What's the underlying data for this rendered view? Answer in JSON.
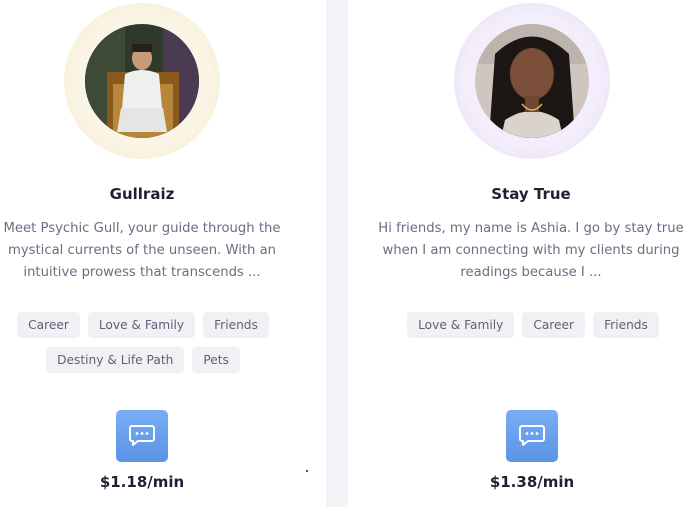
{
  "advisors": [
    {
      "name": "Gullraiz",
      "bio": "Meet Psychic Gull, your guide through the mystical currents of the unseen. With an intuitive prowess that transcends ...",
      "tags": [
        "Career",
        "Love & Family",
        "Friends",
        "Destiny & Life Path",
        "Pets"
      ],
      "price": "$1.18/min",
      "ring_color": "#f3e6c6",
      "chat_icon": "chat-bubble-icon"
    },
    {
      "name": "Stay True",
      "bio": "Hi friends, my name is Ashia. I go by stay true when I am connecting with my clients during readings because I ...",
      "tags": [
        "Love & Family",
        "Career",
        "Friends"
      ],
      "price": "$1.38/min",
      "ring_color": "#e0d6f3",
      "chat_icon": "chat-bubble-icon"
    }
  ],
  "colors": {
    "accent": "#6aa1ee",
    "divider": "#f3f3f7",
    "tag_bg": "#f1f1f5"
  }
}
